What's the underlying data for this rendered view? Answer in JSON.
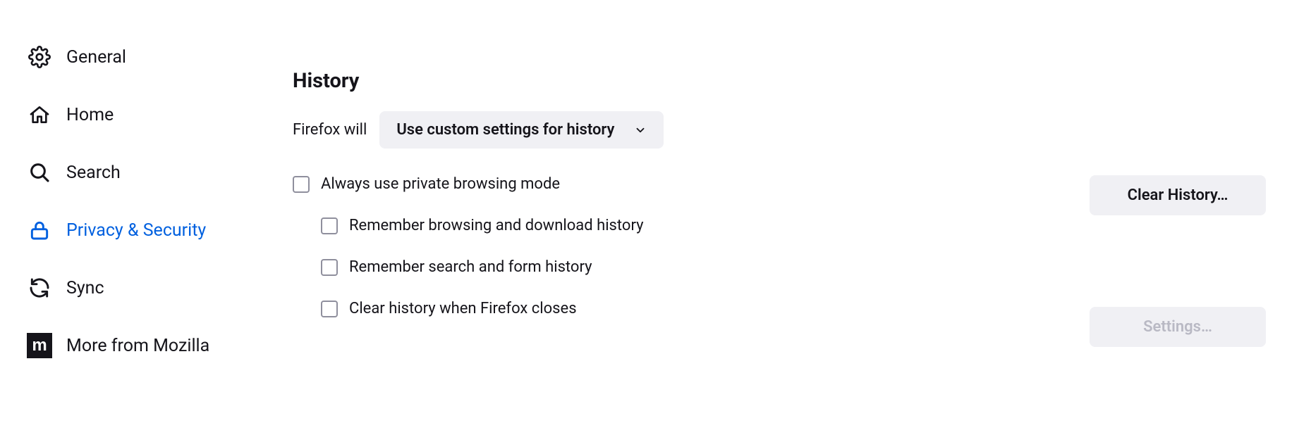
{
  "sidebar": {
    "items": [
      {
        "label": "General"
      },
      {
        "label": "Home"
      },
      {
        "label": "Search"
      },
      {
        "label": "Privacy & Security"
      },
      {
        "label": "Sync"
      },
      {
        "label": "More from Mozilla"
      }
    ]
  },
  "main": {
    "section_title": "History",
    "lead_label": "Firefox will",
    "select_value": "Use custom settings for history",
    "checkboxes": {
      "private_mode": "Always use private browsing mode",
      "remember_browsing": "Remember browsing and download history",
      "remember_search": "Remember search and form history",
      "clear_on_close": "Clear history when Firefox closes"
    },
    "buttons": {
      "clear_history": "Clear History…",
      "settings": "Settings…"
    }
  }
}
